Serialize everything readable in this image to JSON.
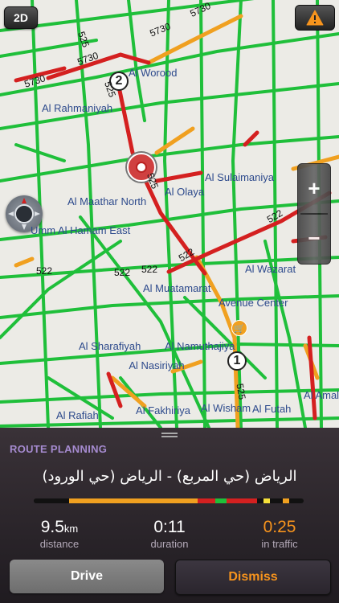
{
  "map": {
    "view_mode_label": "2D",
    "warning_icon": "warning-triangle-icon",
    "zoom_in_label": "+",
    "zoom_out_label": "−",
    "waypoints": [
      "1",
      "2"
    ],
    "districts": [
      "Al Worood",
      "Al Rahmaniyah",
      "Al Sulaimaniya",
      "Al Olaya",
      "Al Maathar North",
      "Umm Al Hamam East",
      "Al Wazarat",
      "Al Muatamarat",
      "Avenue Center",
      "Al Sharafiyah",
      "Al Namuthajiya",
      "Al Nasiriyah",
      "Al Fakhiriya",
      "Al Wisham",
      "Al Futah",
      "Al Rafiah",
      "Al Amal"
    ],
    "road_numbers": [
      "5730",
      "5730",
      "5730",
      "5730",
      "525",
      "525",
      "525",
      "525",
      "522",
      "522",
      "522",
      "522",
      "522"
    ],
    "colors": {
      "free": "#1fbf3a",
      "slow": "#f0a020",
      "jam": "#d42020",
      "background": "#ecebe6"
    }
  },
  "panel": {
    "title": "ROUTE PLANNING",
    "route_name": "الرياض (حي المربع) - الرياض (حي الورود)",
    "distance_value": "9.5",
    "distance_unit": "km",
    "distance_caption": "distance",
    "duration_value": "0:11",
    "duration_caption": "duration",
    "traffic_value": "0:25",
    "traffic_caption": "in traffic",
    "drive_label": "Drive",
    "dismiss_label": "Dismiss",
    "accent_color": "#f7941d",
    "title_color": "#a68bd0"
  }
}
